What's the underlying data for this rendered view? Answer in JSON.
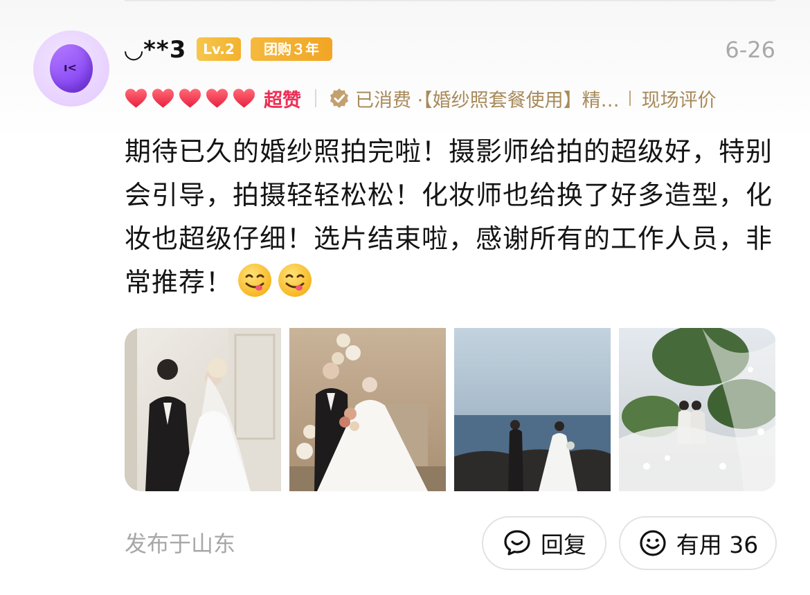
{
  "user": {
    "name": "◡**3",
    "level_badge": "Lv.2",
    "group_buy_badge": "团购３年"
  },
  "date": "6-26",
  "rating": {
    "hearts": 5,
    "label": "超赞"
  },
  "purchase": {
    "consumed_text": "已消费 ·【婚纱照套餐使用】精…",
    "scene_text": "现场评价"
  },
  "review": {
    "text": "期待已久的婚纱照拍完啦！摄影师给拍的超级好，特别会引导，拍摄轻轻松松！化妆师也给换了好多造型，化妆也超级仔细！选片结束啦，感谢所有的工作人员，非常推荐！",
    "emoji_count": 2
  },
  "photos": [
    {
      "icon": "wedding-photo-studio-icon"
    },
    {
      "icon": "wedding-photo-floral-icon"
    },
    {
      "icon": "wedding-photo-seaside-icon"
    },
    {
      "icon": "wedding-photo-veil-icon"
    }
  ],
  "location": "发布于山东",
  "actions": {
    "reply_label": "回复",
    "useful_label": "有用 36"
  },
  "colors": {
    "accent_red": "#ee2d55",
    "gold": "#a88a5a",
    "badge_gold": "#f3b22e",
    "muted": "#a9a9a9"
  }
}
